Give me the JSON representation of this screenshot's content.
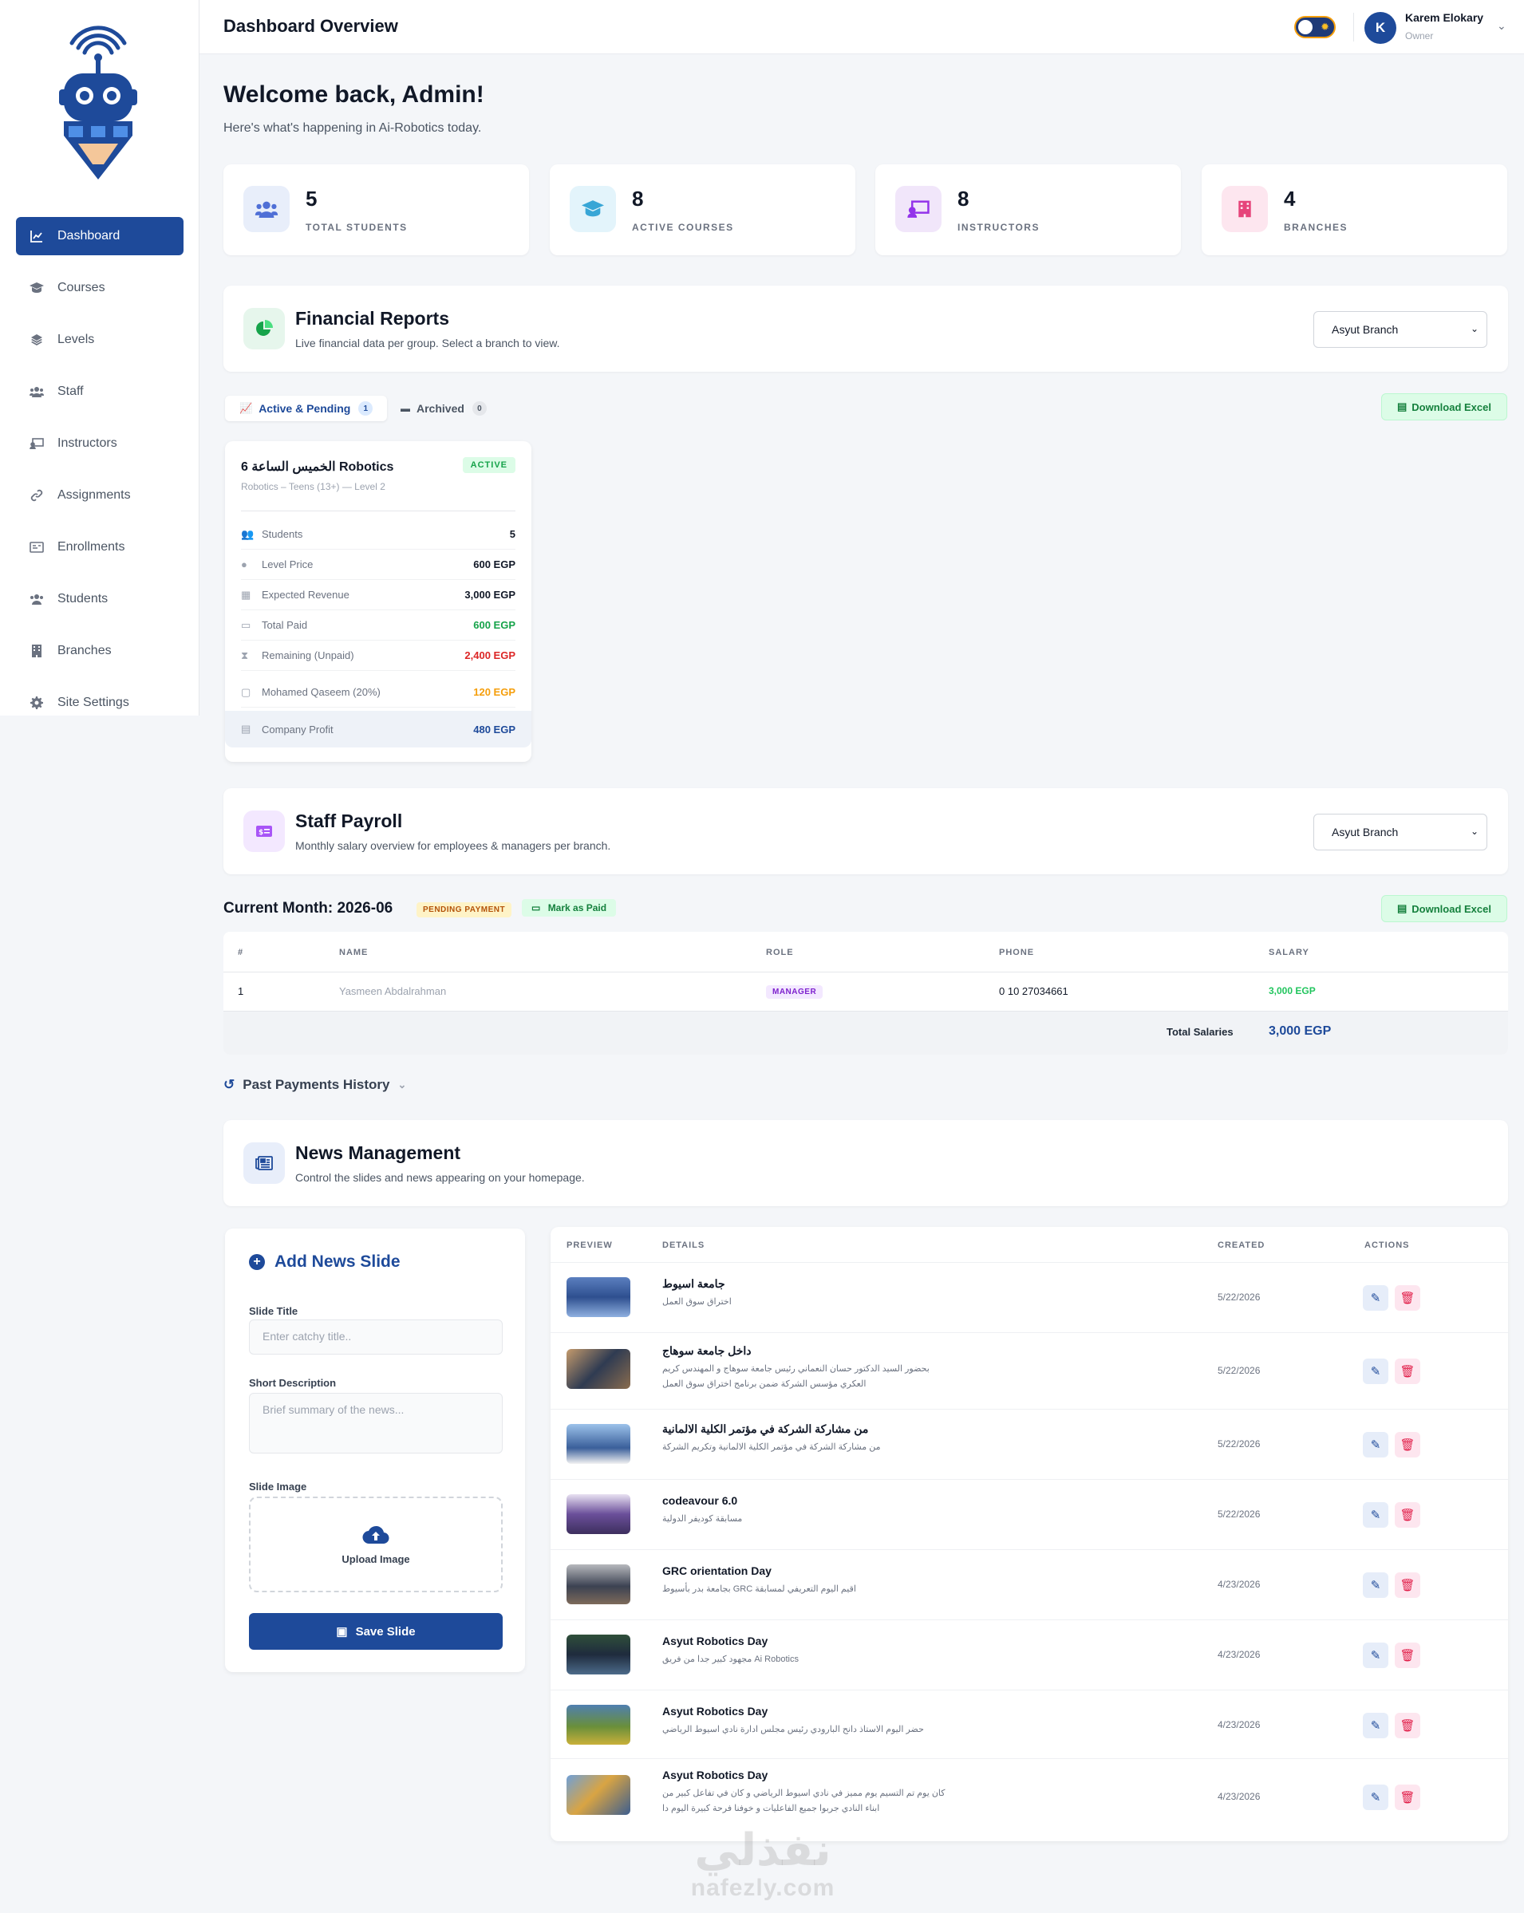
{
  "sidebar": {
    "items": [
      {
        "label": "Dashboard",
        "icon": "chart-line-icon",
        "active": true
      },
      {
        "label": "Courses",
        "icon": "graduation-cap-icon"
      },
      {
        "label": "Levels",
        "icon": "layers-icon"
      },
      {
        "label": "Staff",
        "icon": "users-icon"
      },
      {
        "label": "Instructors",
        "icon": "chalkboard-teacher-icon"
      },
      {
        "label": "Assignments",
        "icon": "link-icon"
      },
      {
        "label": "Enrollments",
        "icon": "id-card-icon"
      },
      {
        "label": "Students",
        "icon": "user-group-icon"
      },
      {
        "label": "Branches",
        "icon": "building-icon"
      },
      {
        "label": "Site Settings",
        "icon": "gear-icon"
      }
    ]
  },
  "topbar": {
    "title": "Dashboard Overview",
    "user": {
      "initial": "K",
      "name": "Karem Elokary",
      "role": "Owner"
    }
  },
  "welcome": {
    "title": "Welcome back, Admin!",
    "subtitle": "Here's what's happening in Ai-Robotics today."
  },
  "stats": [
    {
      "value": "5",
      "label": "TOTAL STUDENTS"
    },
    {
      "value": "8",
      "label": "ACTIVE COURSES"
    },
    {
      "value": "8",
      "label": "INSTRUCTORS"
    },
    {
      "value": "4",
      "label": "BRANCHES"
    }
  ],
  "financial": {
    "title": "Financial Reports",
    "subtitle": "Live financial data per group. Select a branch to view.",
    "branch": "Asyut Branch",
    "tabs": [
      {
        "label": "Active & Pending",
        "count": "1"
      },
      {
        "label": "Archived",
        "count": "0"
      }
    ],
    "download_label": "Download Excel",
    "card": {
      "title": "6 الخميس الساعة Robotics",
      "subtitle": "Robotics – Teens (13+) — Level 2",
      "status": "ACTIVE",
      "rows": [
        {
          "label": "Students",
          "value": "5"
        },
        {
          "label": "Level Price",
          "value": "600 EGP"
        },
        {
          "label": "Expected Revenue",
          "value": "3,000 EGP"
        },
        {
          "label": "Total Paid",
          "value": "600 EGP"
        },
        {
          "label": "Remaining (Unpaid)",
          "value": "2,400 EGP"
        },
        {
          "label": "Mohamed Qaseem (20%)",
          "value": "120 EGP"
        },
        {
          "label": "Company Profit",
          "value": "480 EGP"
        }
      ]
    }
  },
  "payroll": {
    "title": "Staff Payroll",
    "subtitle": "Monthly salary overview for employees & managers per branch.",
    "branch": "Asyut Branch",
    "current_month": "Current Month: 2026-06",
    "status": "PENDING PAYMENT",
    "mark_paid": "Mark as Paid",
    "download_label": "Download Excel",
    "columns": [
      "#",
      "NAME",
      "ROLE",
      "PHONE",
      "SALARY"
    ],
    "rows": [
      {
        "num": "1",
        "name": "Yasmeen Abdalrahman",
        "role": "MANAGER",
        "phone": "0 10 27034661",
        "salary": "3,000 EGP"
      }
    ],
    "total_label": "Total Salaries",
    "total_value": "3,000 EGP",
    "history_label": "Past Payments History"
  },
  "news": {
    "title": "News Management",
    "subtitle": "Control the slides and news appearing on your homepage.",
    "form": {
      "title": "Add News Slide",
      "slide_title_label": "Slide Title",
      "slide_title_placeholder": "Enter catchy title..",
      "desc_label": "Short Description",
      "desc_placeholder": "Brief summary of the news...",
      "image_label": "Slide Image",
      "upload_label": "Upload Image",
      "save_label": "Save Slide"
    },
    "columns": [
      "PREVIEW",
      "DETAILS",
      "CREATED",
      "ACTIONS"
    ],
    "items": [
      {
        "title": "جامعة اسيوط",
        "desc": "اختراق سوق العمل",
        "date": "5/22/2026"
      },
      {
        "title": "داخل جامعة سوهاج",
        "desc": "بحضور السيد الدكتور حسان النعماني رئيس جامعة سوهاج و المهندس كريم العكري مؤسس الشركة ضمن برنامج اختراق سوق العمل",
        "date": "5/22/2026"
      },
      {
        "title": "من مشاركة الشركة في مؤتمر الكلية الالمانية",
        "desc": "من مشاركة الشركة في مؤتمر الكلية الالمانية وتكريم الشركة",
        "date": "5/22/2026"
      },
      {
        "title": "codeavour 6.0",
        "desc": "مسابقة كوديفر الدولية",
        "date": "5/22/2026"
      },
      {
        "title": "GRC orientation Day",
        "desc": "بجامعة بدر بأسيوط GRC اقيم اليوم التعريفي لمسابقة",
        "date": "4/23/2026"
      },
      {
        "title": "Asyut Robotics Day",
        "desc": "مجهود كبير جدا من فريق Ai Robotics",
        "date": "4/23/2026"
      },
      {
        "title": "Asyut Robotics Day",
        "desc": "حضر اليوم الاستاذ دانح البارودي رئيس مجلس ادارة نادي اسيوط الرياضي",
        "date": "4/23/2026"
      },
      {
        "title": "Asyut Robotics Day",
        "desc": "كان يوم تم التسيم يوم مميز في نادي اسيوط الرياضي و كان في تفاعل كبير من ابناء النادي جربوا جميع الفاعليات و خوفنا فرحة كبيرة اليوم دا",
        "date": "4/23/2026"
      }
    ]
  },
  "watermark": {
    "line1": "نفذلي",
    "line2": "nafezly.com"
  }
}
